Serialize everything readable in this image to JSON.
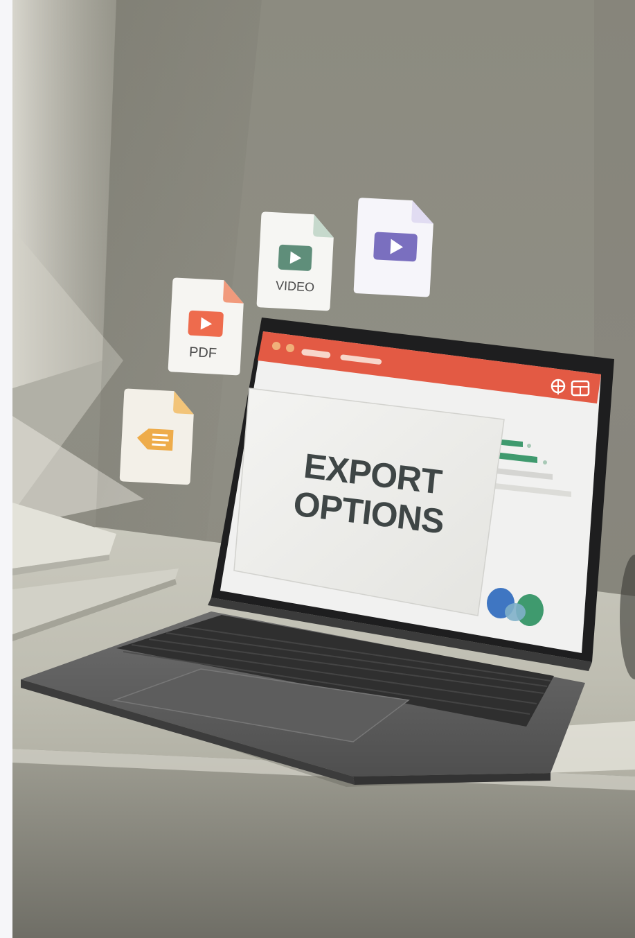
{
  "screen": {
    "title_line1": "EXPORT",
    "title_line2": "OPTIONS"
  },
  "files": {
    "pdf_label": "PDF",
    "video_label": "VIDEO"
  },
  "colors": {
    "app_header": "#e35a44",
    "pdf_icon": "#ee6b4d",
    "video_icon": "#5f8e7a",
    "slides_icon": "#7a6fbf",
    "doc_icon": "#eeac4a",
    "chart_green": "#3f9a6e",
    "wall": "#8c8b80"
  },
  "icons": {
    "app_toolbar_left": "window-dots-icon",
    "app_toolbar_right_1": "globe-icon",
    "app_toolbar_right_2": "layout-icon"
  }
}
